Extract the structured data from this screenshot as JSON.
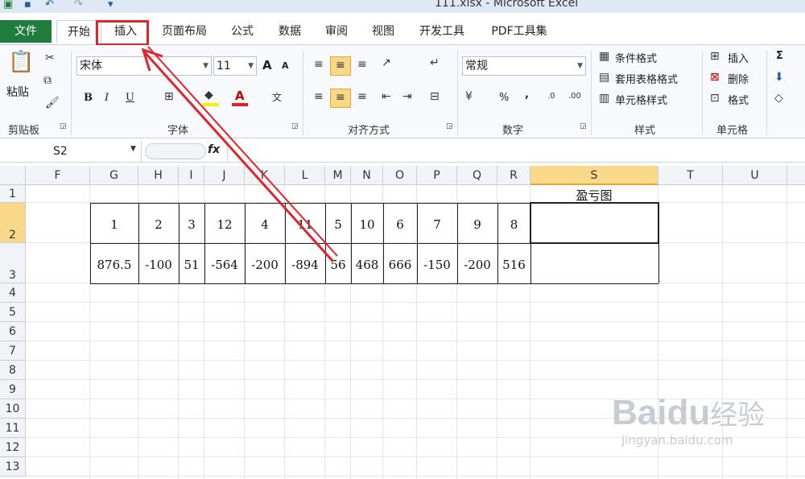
{
  "window": {
    "title": "111.xlsx - Microsoft Excel"
  },
  "tabs": {
    "file": "文件",
    "home": "开始",
    "insert": "插入",
    "page_layout": "页面布局",
    "formulas": "公式",
    "data": "数据",
    "review": "审阅",
    "view": "视图",
    "developer": "开发工具",
    "pdf": "PDF工具集"
  },
  "ribbon": {
    "clipboard": {
      "label": "剪贴板",
      "paste": "粘贴"
    },
    "font": {
      "label": "字体",
      "name": "宋体",
      "size": "11",
      "bold": "B",
      "italic": "I",
      "underline": "U",
      "grow": "A",
      "shrink": "A",
      "font_color": "A"
    },
    "alignment": {
      "label": "对齐方式"
    },
    "number": {
      "label": "数字",
      "format": "常规",
      "percent": "%",
      "comma": ","
    },
    "styles": {
      "label": "样式",
      "conditional": "条件格式",
      "table_format": "套用表格格式",
      "cell_styles": "单元格样式"
    },
    "cells": {
      "label": "单元格",
      "insert": "插入",
      "delete": "删除",
      "format": "格式"
    },
    "editing": {
      "sum": "Σ"
    }
  },
  "formula_bar": {
    "name_box": "S2",
    "fx": "fx",
    "value": ""
  },
  "sheet": {
    "columns": [
      "F",
      "G",
      "H",
      "I",
      "J",
      "K",
      "L",
      "M",
      "N",
      "O",
      "P",
      "Q",
      "R",
      "S",
      "T",
      "U"
    ],
    "rows": [
      "1",
      "2",
      "3",
      "4",
      "5",
      "6",
      "7",
      "8",
      "9",
      "10",
      "11",
      "12",
      "13"
    ],
    "selected_column": "S",
    "selected_row": "2",
    "title_cell": "盈亏图",
    "row2": [
      "1",
      "2",
      "3",
      "12",
      "4",
      "11",
      "5",
      "10",
      "6",
      "7",
      "9",
      "8"
    ],
    "row3": [
      "876.5",
      "-100",
      "51",
      "-564",
      "-200",
      "-894",
      "56",
      "468",
      "666",
      "-150",
      "-200",
      "516"
    ]
  },
  "watermark": {
    "brand": "Bai",
    "brand2": "du",
    "brand3": "经验",
    "url": "jingyan.baidu.com"
  },
  "colors": {
    "accent": "#1e7d3c",
    "annotation": "#e0242a",
    "selection": "#f9d88a"
  }
}
